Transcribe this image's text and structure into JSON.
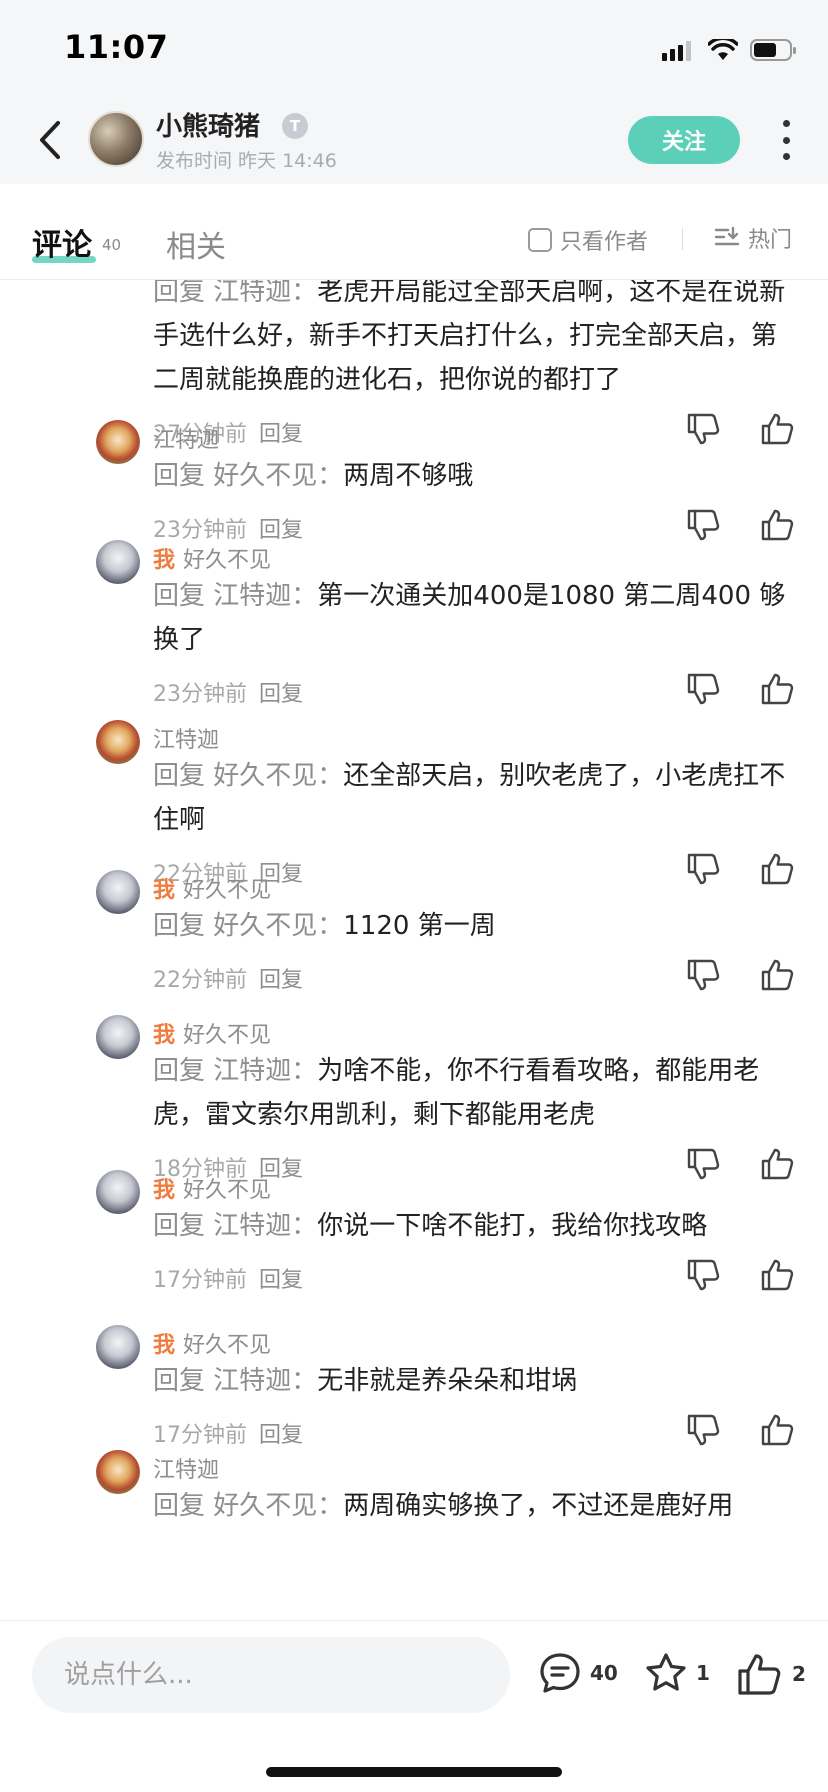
{
  "status_bar": {
    "time": "11:07"
  },
  "header": {
    "author_name": "小熊琦猪",
    "badge": "T",
    "publish_time": "发布时间 昨天 14:46",
    "follow_label": "关注"
  },
  "tabs": {
    "comment_label": "评论",
    "comment_count": "40",
    "related_label": "相关",
    "author_only_label": "只看作者",
    "sort_label": "热门"
  },
  "reply_prefix": "回复",
  "reply_action": "回复",
  "me_tag": "我",
  "replies": [
    {
      "me": true,
      "user": "好久不见",
      "to": "江特迦：",
      "text": "老虎开局能过全部天启啊，这不是在说新手选什么好，新手不打天启打什么，打完全部天启，第二周就能换鹿的进化石，把你说的都打了",
      "time": "27分钟前"
    },
    {
      "me": false,
      "user": "江特迦",
      "to": "好久不见：",
      "text": "两周不够哦",
      "time": "23分钟前"
    },
    {
      "me": true,
      "user": "好久不见",
      "to": "江特迦：",
      "text": "第一次通关加400是1080 第二周400 够换了",
      "time": "23分钟前"
    },
    {
      "me": false,
      "user": "江特迦",
      "to": "好久不见：",
      "text": "还全部天启，别吹老虎了，小老虎扛不住啊",
      "time": "22分钟前"
    },
    {
      "me": true,
      "user": "好久不见",
      "to": "好久不见：",
      "text": "1120 第一周",
      "time": "22分钟前"
    },
    {
      "me": true,
      "user": "好久不见",
      "to": "江特迦：",
      "text": "为啥不能，你不行看看攻略，都能用老虎，雷文索尔用凯利，剩下都能用老虎",
      "time": "18分钟前"
    },
    {
      "me": true,
      "user": "好久不见",
      "to": "江特迦：",
      "text": "你说一下啥不能打，我给你找攻略",
      "time": "17分钟前"
    },
    {
      "me": true,
      "user": "好久不见",
      "to": "江特迦：",
      "text": "无非就是养朵朵和坩埚",
      "time": "17分钟前"
    },
    {
      "me": false,
      "user": "江特迦",
      "to": "好久不见：",
      "text": "两周确实够换了，不过还是鹿好用",
      "time": ""
    }
  ],
  "bottom_bar": {
    "input_placeholder": "说点什么...",
    "comment_count": "40",
    "favorite_count": "1",
    "like_count": "2"
  },
  "colors": {
    "accent": "#5ccfb9",
    "me_tag": "#f07b3e",
    "secondary_text": "#8e8e8e"
  }
}
